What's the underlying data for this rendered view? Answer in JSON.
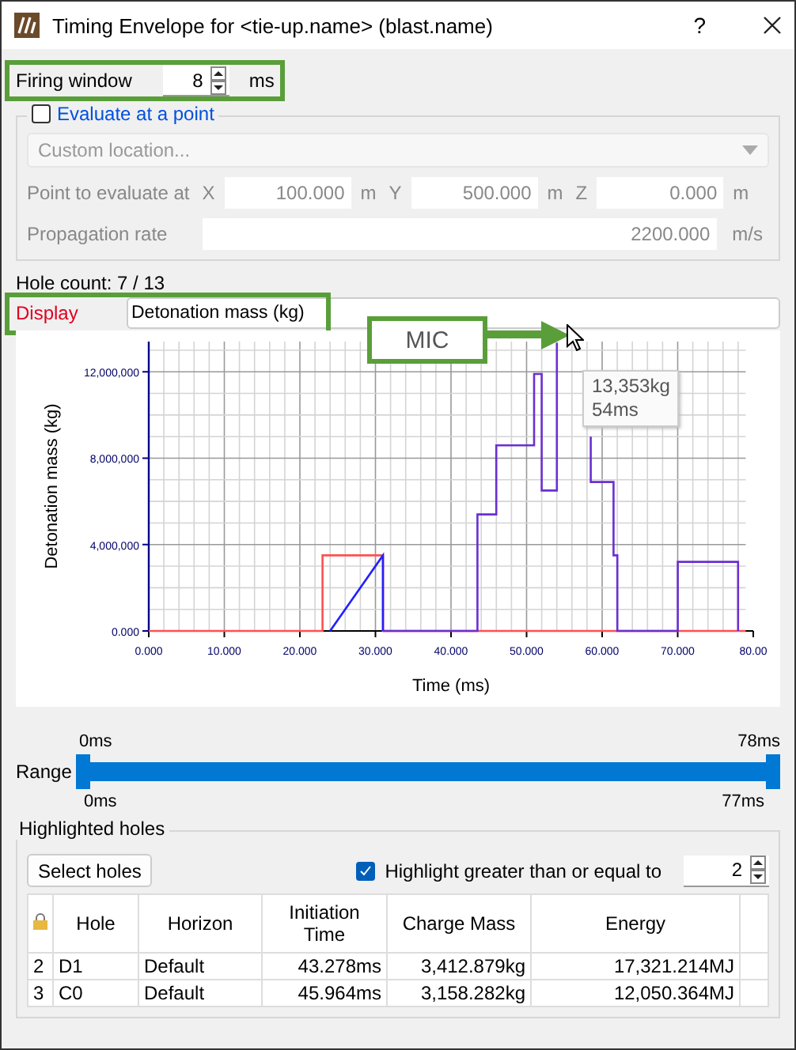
{
  "window": {
    "title": "Timing Envelope for <tie-up.name> (blast.name)",
    "help": "?"
  },
  "firing_window": {
    "label": "Firing window",
    "value": "8",
    "unit": "ms",
    "highlighted": true
  },
  "evaluate": {
    "label": "Evaluate at a point",
    "checked": false,
    "disabled": true,
    "location": "Custom location...",
    "point_label": "Point to evaluate at",
    "coords": [
      {
        "axis": "X",
        "value": "100.000",
        "unit": "m"
      },
      {
        "axis": "Y",
        "value": "500.000",
        "unit": "m"
      },
      {
        "axis": "Z",
        "value": "0.000",
        "unit": "m"
      }
    ],
    "propagation": {
      "label": "Propagation rate",
      "value": "2200.000",
      "unit": "m/s"
    }
  },
  "hole_count": "Hole count: 7 / 13",
  "display": {
    "label": "Display",
    "value": "Detonation mass (kg)",
    "highlighted": true
  },
  "chart": {
    "chart_data": {
      "type": "line",
      "grid": true,
      "xlabel": "Time (ms)",
      "ylabel": "Detonation mass (kg)",
      "xlim": [
        0,
        80
      ],
      "ylim": [
        0,
        13400000
      ],
      "xticks": [
        {
          "value": 0,
          "label": "0.000"
        },
        {
          "value": 10,
          "label": "10.000"
        },
        {
          "value": 20,
          "label": "20.000"
        },
        {
          "value": 30,
          "label": "30.000"
        },
        {
          "value": 40,
          "label": "40.000"
        },
        {
          "value": 50,
          "label": "50.000"
        },
        {
          "value": 60,
          "label": "60.000"
        },
        {
          "value": 70,
          "label": "70.000"
        },
        {
          "value": 80,
          "label": "80.00"
        }
      ],
      "yticks": [
        {
          "value": 0,
          "label": "0.000"
        },
        {
          "value": 4000000,
          "label": "4,000,000"
        },
        {
          "value": 8000000,
          "label": "8,000,000"
        },
        {
          "value": 12000000,
          "label": "12,000,000"
        }
      ],
      "series": [
        {
          "color": "#ff5050",
          "x": [
            0,
            23,
            23,
            31,
            31,
            79
          ],
          "values": [
            0,
            0,
            3500000,
            3500000,
            0,
            0
          ]
        },
        {
          "color": "#2020ff",
          "x": [
            24,
            31,
            31
          ],
          "values": [
            0,
            3500000,
            0
          ]
        },
        {
          "color": "#6a2fd0",
          "x": [
            31,
            43.5,
            43.5,
            46,
            46,
            51,
            51,
            52,
            52,
            54,
            54,
            54,
            56,
            58.5,
            58.5,
            61.5,
            61.5,
            62,
            62,
            70,
            70,
            78,
            78
          ],
          "values": [
            0,
            0,
            5400000,
            5400000,
            8600000,
            8600000,
            11900000,
            11900000,
            6500000,
            6500000,
            9800000,
            13350000,
            null,
            9000000,
            6900000,
            6900000,
            3500000,
            3500000,
            0,
            0,
            3200000,
            3200000,
            0
          ]
        }
      ]
    },
    "tooltip": [
      "13,353kg",
      "54ms"
    ],
    "callout": "MIC"
  },
  "range": {
    "label": "Range",
    "level": 1,
    "top_start": "0ms",
    "top_end": "78ms",
    "bottom_start": "0ms",
    "bottom_end": "77ms"
  },
  "highlighted_holes": {
    "title": "Highlighted holes",
    "select_button": "Select holes",
    "threshold": {
      "label": "Highlight greater than or equal to",
      "checked": true,
      "value": "2"
    },
    "table": {
      "columns": [
        "",
        "Hole",
        "Horizon",
        "Initiation Time",
        "Charge Mass",
        "Energy"
      ],
      "rows": [
        {
          "cells": [
            "2",
            "D1",
            "Default",
            "43.278ms",
            "3,412.879kg",
            "17,321.214MJ"
          ]
        },
        {
          "cells": [
            "3",
            "C0",
            "Default",
            "45.964ms",
            "3,158.282kg",
            "12,050.364MJ"
          ]
        }
      ]
    }
  }
}
